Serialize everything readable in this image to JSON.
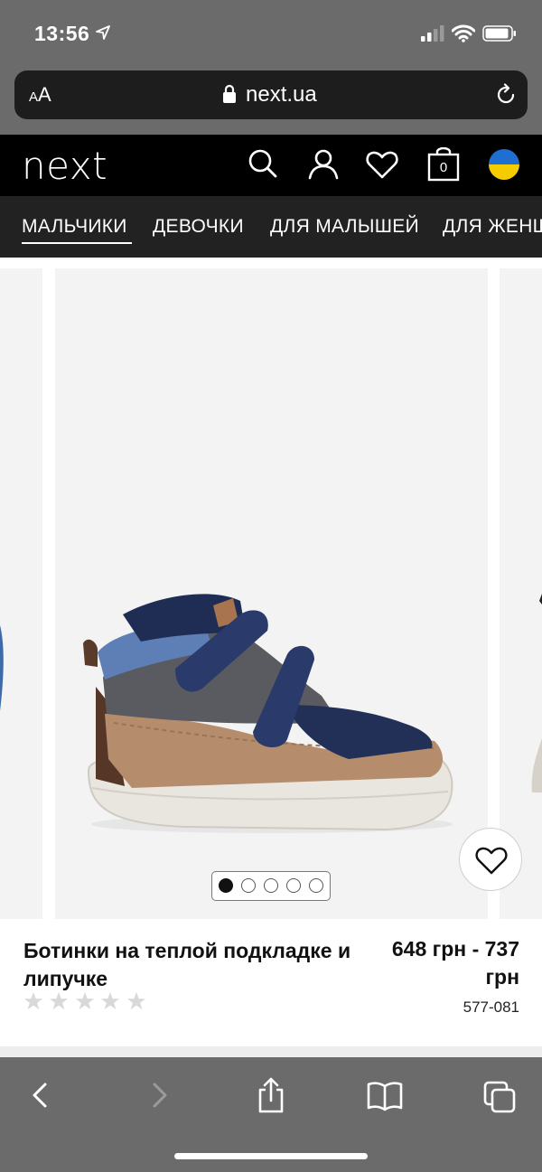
{
  "status_bar": {
    "time": "13:56"
  },
  "browser": {
    "text_size_label": "AA",
    "domain": "next.ua"
  },
  "site": {
    "logo": "next",
    "bag_count": "0",
    "icons": [
      "search-icon",
      "account-icon",
      "favourites-heart-icon",
      "bag-icon",
      "ukraine-flag-icon"
    ]
  },
  "category_nav": {
    "items": [
      "МАЛЬЧИКИ",
      "ДЕВОЧКИ",
      "ДЛЯ МАЛЫШЕЙ",
      "ДЛЯ ЖЕНЩИН"
    ],
    "active_index": 0
  },
  "gallery": {
    "image_count": 5,
    "active_image": 1
  },
  "product": {
    "title": "Ботинки на теплой подкладке и липучке",
    "price": "648 грн - 737 грн",
    "sku": "577-081",
    "rating": 0,
    "rating_max": 5
  },
  "colors": {
    "header_bg": "#000000",
    "nav_bg": "#222222",
    "chrome_bg": "#6b6b6b"
  },
  "toolbar": {
    "icons": [
      "back-icon",
      "forward-icon",
      "share-icon",
      "bookmarks-icon",
      "tabs-icon"
    ]
  }
}
